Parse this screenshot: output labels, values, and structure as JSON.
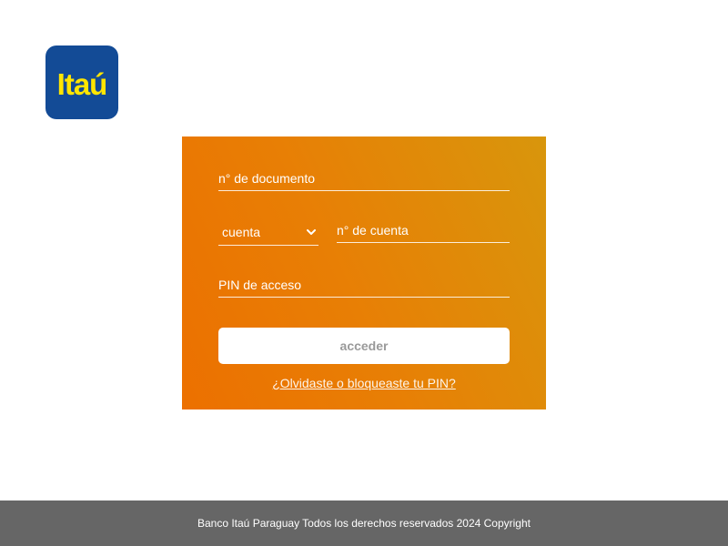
{
  "brand": {
    "logo_text": "Itaú",
    "logo_bg_color": "#134b96",
    "logo_text_color": "#ffe600"
  },
  "login_form": {
    "accent_color": "#ec7000",
    "documento_placeholder": "n° de documento",
    "documento_value": "",
    "account_type_selected": "cuenta",
    "cuenta_placeholder": "n° de cuenta",
    "cuenta_value": "",
    "pin_placeholder": "PIN de acceso",
    "pin_value": "",
    "submit_label": "acceder",
    "forgot_link": "¿Olvidaste o bloqueaste tu PIN?"
  },
  "footer": {
    "text": "Banco Itaú Paraguay Todos los derechos reservados 2024 Copyright",
    "bg_color": "#666666"
  },
  "icons": {
    "select_chevron": "chevron-down-icon"
  }
}
